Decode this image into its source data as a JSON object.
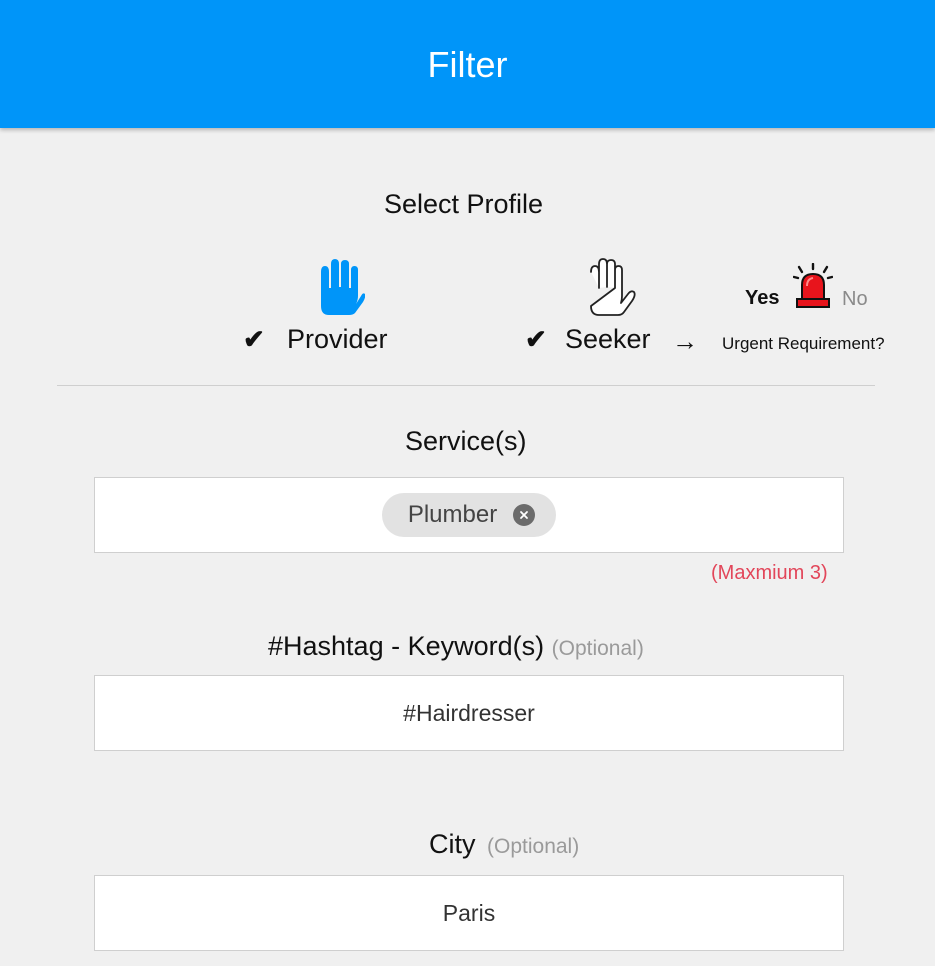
{
  "header": {
    "title": "Filter"
  },
  "profile": {
    "title": "Select Profile",
    "provider": {
      "label": "Provider",
      "check": "✔",
      "icon": "raised-hand-filled-icon",
      "color": "#0095f9"
    },
    "seeker": {
      "label": "Seeker",
      "check": "✔",
      "icon": "raised-hand-outline-icon"
    },
    "arrow": "→",
    "urgent": {
      "yes": "Yes",
      "no": "No",
      "label": "Urgent Requirement?",
      "icon": "siren-icon"
    }
  },
  "services": {
    "title": "Service(s)",
    "chips": [
      {
        "label": "Plumber"
      }
    ],
    "max_note": "(Maxmium 3)"
  },
  "hashtag": {
    "title": "#Hashtag - Keyword(s)",
    "optional": "(Optional)",
    "value": "#Hairdresser"
  },
  "city": {
    "title": "City",
    "optional": "(Optional)",
    "value": "Paris"
  },
  "colors": {
    "accent": "#0095f9",
    "warning": "#e2465a",
    "siren": "#e8141c"
  }
}
